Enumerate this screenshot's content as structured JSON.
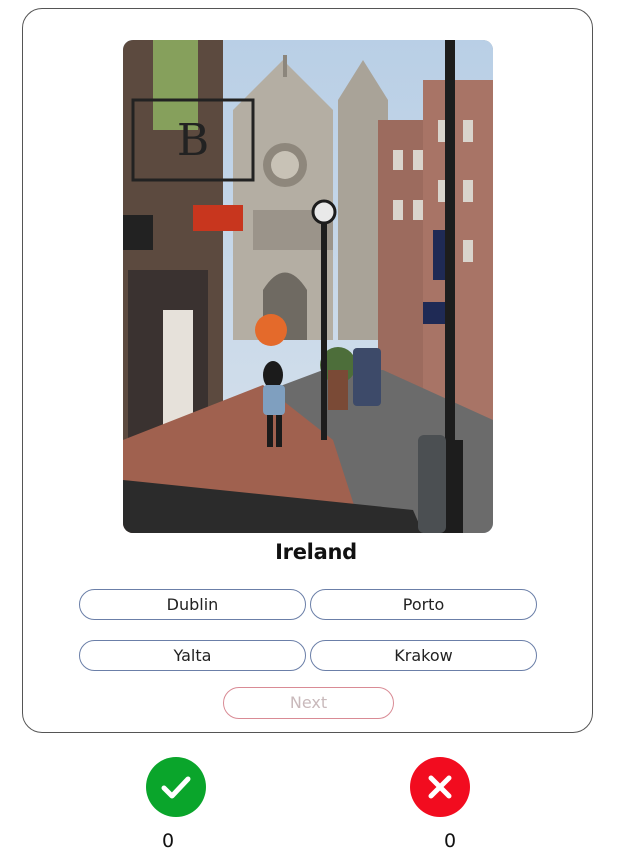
{
  "quiz": {
    "country": "Ireland",
    "options": [
      "Dublin",
      "Porto",
      "Yalta",
      "Krakow"
    ],
    "next_label": "Next"
  },
  "score": {
    "correct": "0",
    "wrong": "0"
  },
  "colors": {
    "correct": "#0aa52b",
    "wrong": "#f20c1f",
    "option_border": "#6b7fa8",
    "next_border": "#d98b95"
  }
}
